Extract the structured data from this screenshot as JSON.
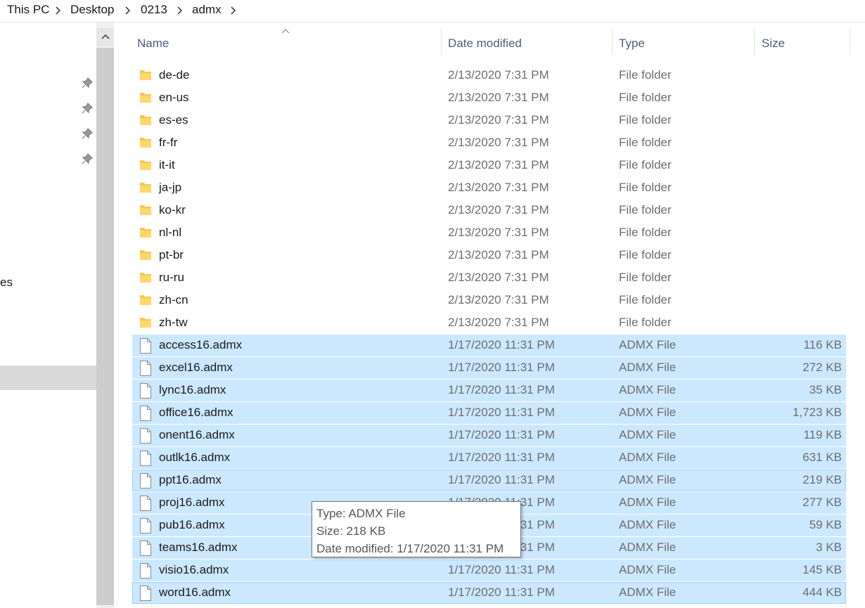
{
  "breadcrumb": {
    "items": [
      "This PC",
      "Desktop",
      "0213",
      "admx"
    ]
  },
  "nav": {
    "fragment_text": "es",
    "pin_icon": "pin-icon"
  },
  "columns": {
    "name": "Name",
    "date": "Date modified",
    "type": "Type",
    "size": "Size"
  },
  "rows": [
    {
      "name": "de-de",
      "date": "2/13/2020 7:31 PM",
      "type": "File folder",
      "size": "",
      "icon": "folder-icon",
      "selected": false
    },
    {
      "name": "en-us",
      "date": "2/13/2020 7:31 PM",
      "type": "File folder",
      "size": "",
      "icon": "folder-icon",
      "selected": false
    },
    {
      "name": "es-es",
      "date": "2/13/2020 7:31 PM",
      "type": "File folder",
      "size": "",
      "icon": "folder-icon",
      "selected": false
    },
    {
      "name": "fr-fr",
      "date": "2/13/2020 7:31 PM",
      "type": "File folder",
      "size": "",
      "icon": "folder-icon",
      "selected": false
    },
    {
      "name": "it-it",
      "date": "2/13/2020 7:31 PM",
      "type": "File folder",
      "size": "",
      "icon": "folder-icon",
      "selected": false
    },
    {
      "name": "ja-jp",
      "date": "2/13/2020 7:31 PM",
      "type": "File folder",
      "size": "",
      "icon": "folder-icon",
      "selected": false
    },
    {
      "name": "ko-kr",
      "date": "2/13/2020 7:31 PM",
      "type": "File folder",
      "size": "",
      "icon": "folder-icon",
      "selected": false
    },
    {
      "name": "nl-nl",
      "date": "2/13/2020 7:31 PM",
      "type": "File folder",
      "size": "",
      "icon": "folder-icon",
      "selected": false
    },
    {
      "name": "pt-br",
      "date": "2/13/2020 7:31 PM",
      "type": "File folder",
      "size": "",
      "icon": "folder-icon",
      "selected": false
    },
    {
      "name": "ru-ru",
      "date": "2/13/2020 7:31 PM",
      "type": "File folder",
      "size": "",
      "icon": "folder-icon",
      "selected": false
    },
    {
      "name": "zh-cn",
      "date": "2/13/2020 7:31 PM",
      "type": "File folder",
      "size": "",
      "icon": "folder-icon",
      "selected": false
    },
    {
      "name": "zh-tw",
      "date": "2/13/2020 7:31 PM",
      "type": "File folder",
      "size": "",
      "icon": "folder-icon",
      "selected": false
    },
    {
      "name": "access16.admx",
      "date": "1/17/2020 11:31 PM",
      "type": "ADMX File",
      "size": "116 KB",
      "icon": "file-icon",
      "selected": true
    },
    {
      "name": "excel16.admx",
      "date": "1/17/2020 11:31 PM",
      "type": "ADMX File",
      "size": "272 KB",
      "icon": "file-icon",
      "selected": true
    },
    {
      "name": "lync16.admx",
      "date": "1/17/2020 11:31 PM",
      "type": "ADMX File",
      "size": "35 KB",
      "icon": "file-icon",
      "selected": true
    },
    {
      "name": "office16.admx",
      "date": "1/17/2020 11:31 PM",
      "type": "ADMX File",
      "size": "1,723 KB",
      "icon": "file-icon",
      "selected": true
    },
    {
      "name": "onent16.admx",
      "date": "1/17/2020 11:31 PM",
      "type": "ADMX File",
      "size": "119 KB",
      "icon": "file-icon",
      "selected": true
    },
    {
      "name": "outlk16.admx",
      "date": "1/17/2020 11:31 PM",
      "type": "ADMX File",
      "size": "631 KB",
      "icon": "file-icon",
      "selected": true
    },
    {
      "name": "ppt16.admx",
      "date": "1/17/2020 11:31 PM",
      "type": "ADMX File",
      "size": "219 KB",
      "icon": "file-icon",
      "selected": true,
      "hover": true
    },
    {
      "name": "proj16.admx",
      "date": "1/17/2020 11:31 PM",
      "type": "ADMX File",
      "size": "277 KB",
      "icon": "file-icon",
      "selected": true
    },
    {
      "name": "pub16.admx",
      "date": "1/17/2020 11:31 PM",
      "type": "ADMX File",
      "size": "59 KB",
      "icon": "file-icon",
      "selected": true
    },
    {
      "name": "teams16.admx",
      "date": "1/17/2020 11:31 PM",
      "type": "ADMX File",
      "size": "3 KB",
      "icon": "file-icon",
      "selected": true
    },
    {
      "name": "visio16.admx",
      "date": "1/17/2020 11:31 PM",
      "type": "ADMX File",
      "size": "145 KB",
      "icon": "file-icon",
      "selected": true
    },
    {
      "name": "word16.admx",
      "date": "1/17/2020 11:31 PM",
      "type": "ADMX File",
      "size": "444 KB",
      "icon": "file-icon",
      "selected": true,
      "hover": true
    }
  ],
  "tooltip": {
    "type_line": "Type: ADMX File",
    "size_line": "Size: 218 KB",
    "date_line": "Date modified: 1/17/2020 11:31 PM"
  },
  "colors": {
    "selection": "#cce8ff",
    "selection_border": "#99d1ff",
    "header_text": "#4c607a",
    "folder": "#f5c74f"
  }
}
